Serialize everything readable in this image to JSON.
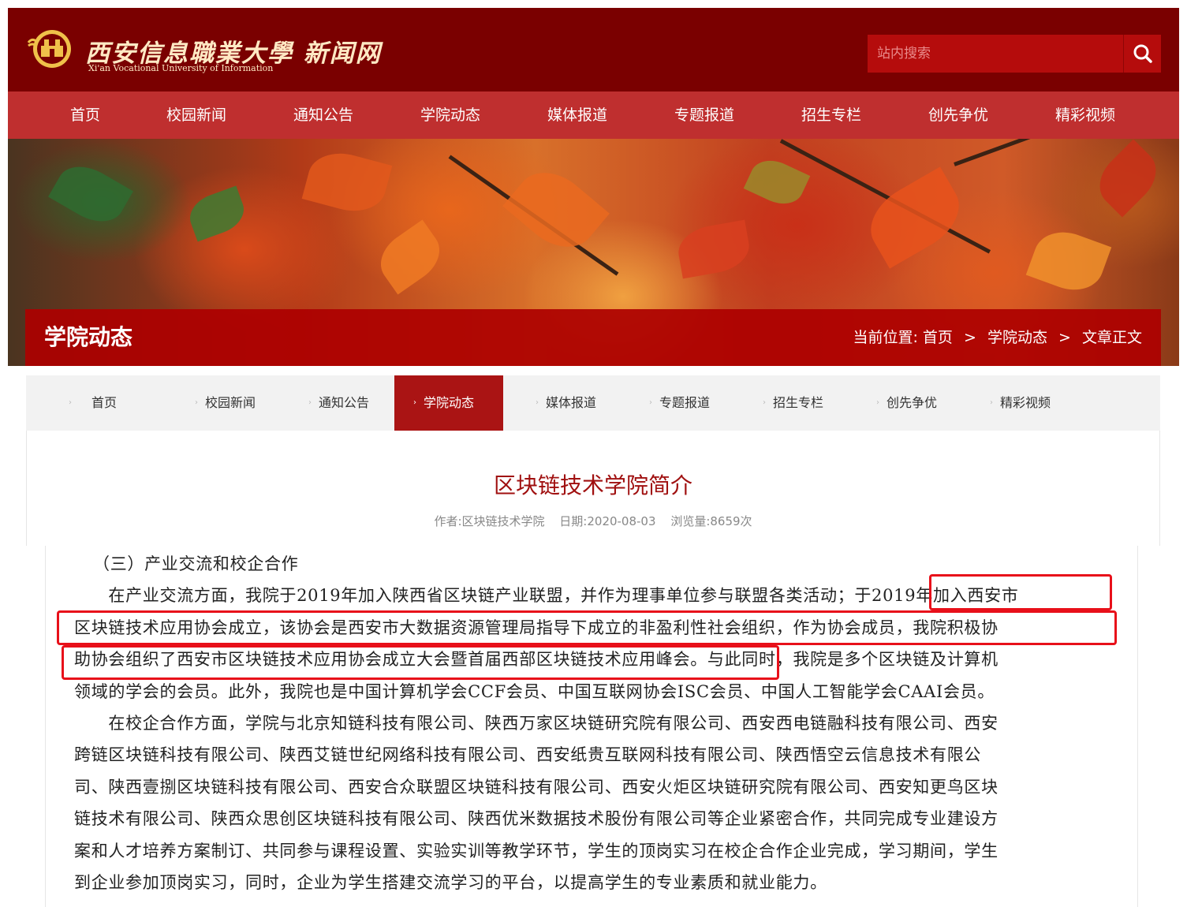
{
  "header": {
    "logo_cn": "西安信息職業大學 新闻网",
    "logo_en": "Xi'an Vocational University of Information",
    "search_placeholder": "站内搜索"
  },
  "main_nav": [
    "首页",
    "校园新闻",
    "通知公告",
    "学院动态",
    "媒体报道",
    "专题报道",
    "招生专栏",
    "创先争优",
    "精彩视频"
  ],
  "banner": {
    "section_title": "学院动态",
    "breadcrumb_prefix": "当前位置:",
    "breadcrumb": [
      "首页",
      "学院动态",
      "文章正文"
    ],
    "breadcrumb_separator": ">"
  },
  "sub_nav": {
    "items": [
      "首页",
      "校园新闻",
      "通知公告",
      "学院动态",
      "媒体报道",
      "专题报道",
      "招生专栏",
      "创先争优",
      "精彩视频"
    ],
    "active": "学院动态"
  },
  "article": {
    "title": "区块链技术学院简介",
    "author": "作者:区块链技术学院",
    "date": "日期:2020-08-03",
    "views": "浏览量:8659次",
    "lines": [
      "（三）产业交流和校企合作",
      "　　在产业交流方面，我院于2019年加入陕西省区块链产业联盟，并作为理事单位参与联盟各类活动；于2019年加入西安市",
      "区块链技术应用协会成立，该协会是西安市大数据资源管理局指导下成立的非盈利性社会组织，作为协会成员，我院积极协",
      "助协会组织了西安市区块链技术应用协会成立大会暨首届西部区块链技术应用峰会。与此同时，我院是多个区块链及计算机",
      "领域的学会的会员。此外，我院也是中国计算机学会CCF会员、中国互联网协会ISC会员、中国人工智能学会CAAI会员。",
      "　　在校企合作方面，学院与北京知链科技有限公司、陕西万家区块链研究院有限公司、西安西电链融科技有限公司、西安",
      "跨链区块链科技有限公司、陕西艾链世纪网络科技有限公司、西安纸贵互联网科技有限公司、陕西悟空云信息技术有限公",
      "司、陕西壹捌区块链科技有限公司、西安合众联盟区块链科技有限公司、西安火炬区块链研究院有限公司、西安知更鸟区块",
      "链技术有限公司、陕西众思创区块链科技有限公司、陕西优米数据技术股份有限公司等企业紧密合作，共同完成专业建设方",
      "案和人才培养方案制订、共同参与课程设置、实验实训等教学环节，学生的顶岗实习在校企合作企业完成，学习期间，学生",
      "到企业参加顶岗实习，同时，企业为学生搭建交流学习的平台，以提高学生的专业素质和就业能力。"
    ]
  },
  "colors": {
    "header_bg": "#7a0000",
    "nav_bg": "#bf2f2f",
    "banner_bar": "#ac0000",
    "active_tab": "#aa1414",
    "title_color": "#a01010",
    "highlight_border": "#e8101a"
  }
}
